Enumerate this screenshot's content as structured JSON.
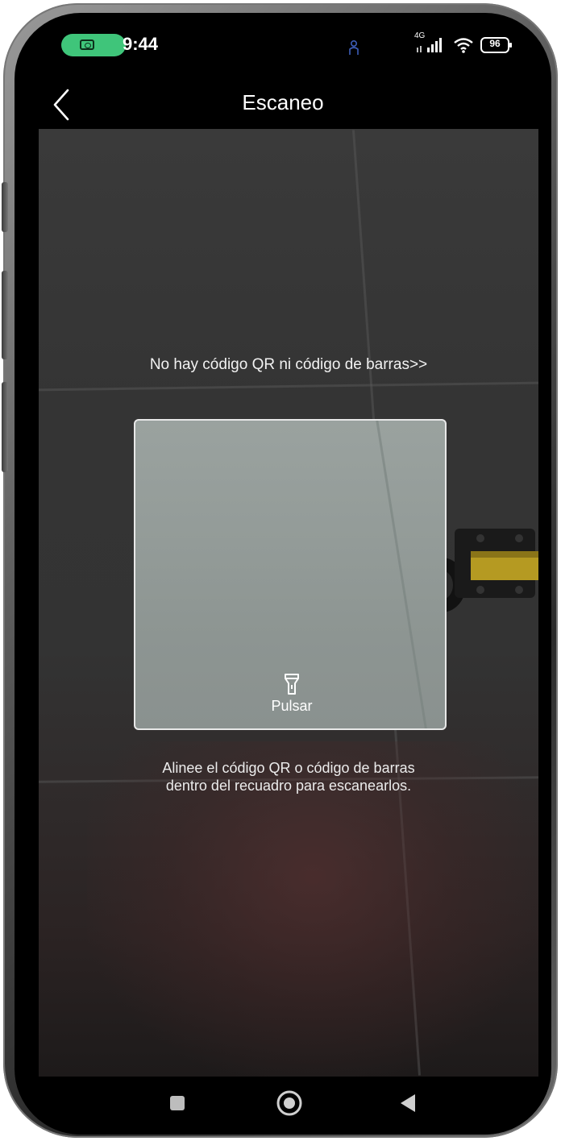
{
  "status_bar": {
    "time": "9:44",
    "network": "4G",
    "battery": "96",
    "icons": [
      "camera-in-use-icon",
      "person-icon",
      "signal-icon",
      "wifi-icon",
      "battery-icon"
    ]
  },
  "header": {
    "title": "Escaneo",
    "back_icon": "chevron-left-icon"
  },
  "scanner": {
    "no_code_link": "No hay código QR ni código de barras>>",
    "flashlight_label": "Pulsar",
    "hint_line1": "Alinee el código QR o código de barras",
    "hint_line2": "dentro del recuadro para escanearlos."
  },
  "nav_bar": {
    "buttons": [
      "recents-square-icon",
      "home-circle-icon",
      "back-triangle-icon"
    ]
  },
  "colors": {
    "camera_pill": "#3fc57a",
    "screen_bg": "#000000",
    "frame_border": "#e8e8e8"
  }
}
